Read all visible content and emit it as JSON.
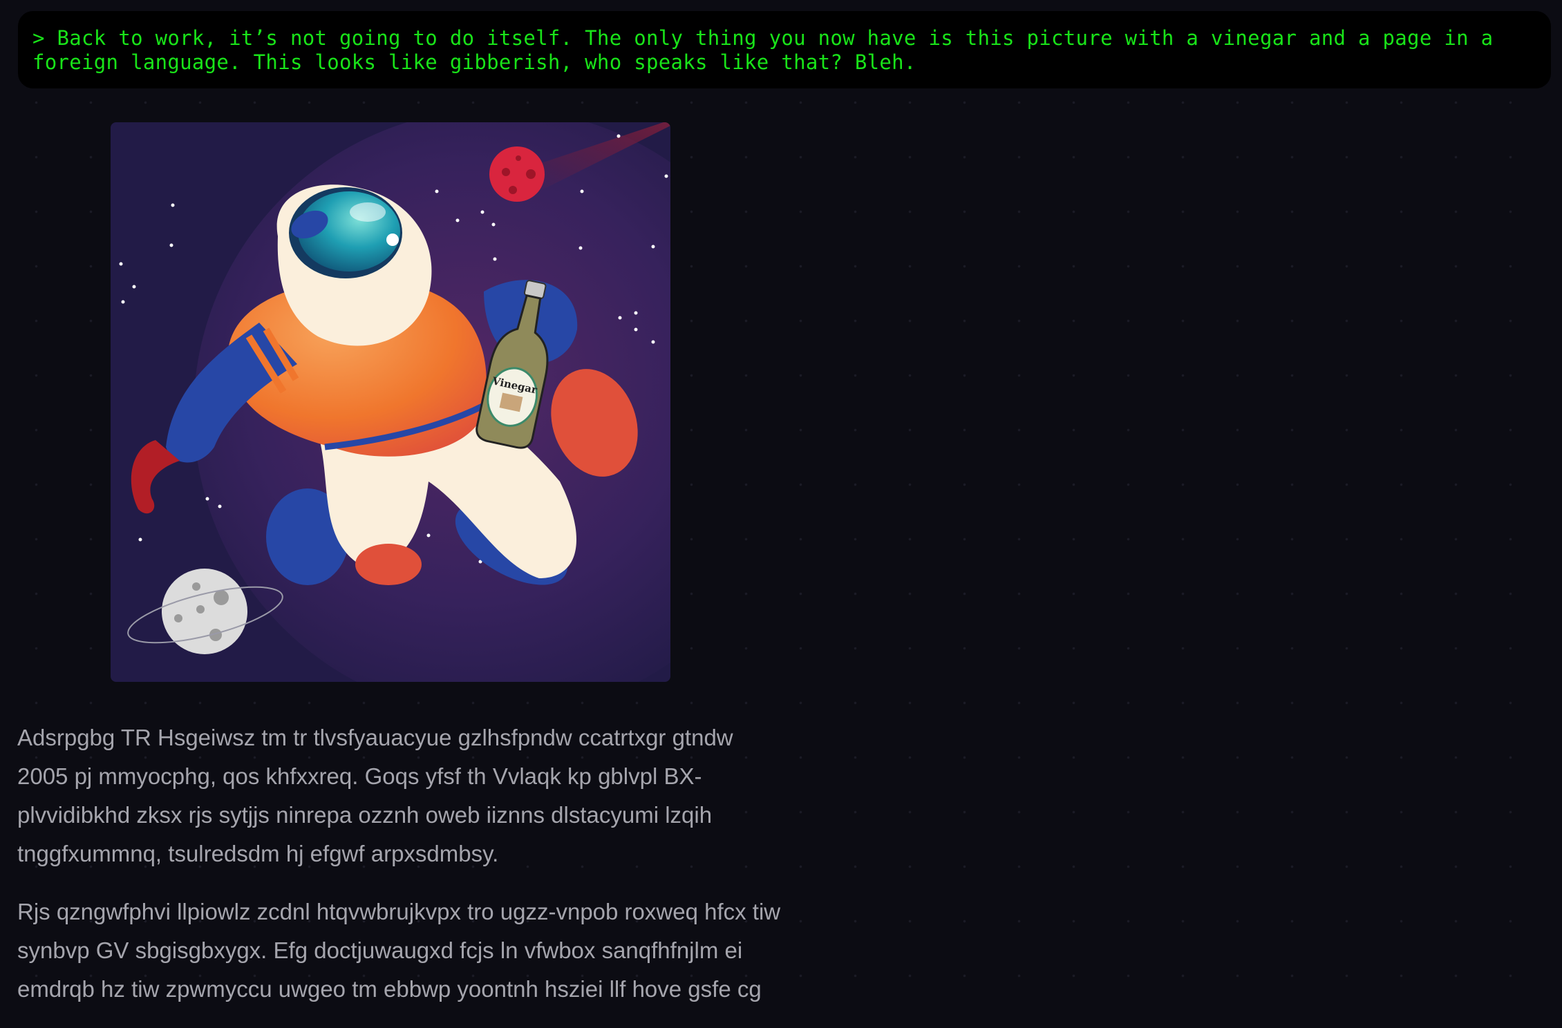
{
  "terminal": {
    "text": "> Back to work, it’s not going to do itself. The only thing you now have is this picture with a vinegar and a page in a\nforeign language. This looks like gibberish, who speaks like that? Bleh."
  },
  "illustration": {
    "bottle_label": "Vinegar",
    "colors": {
      "background": "#221b47",
      "suit_orange": "#f0762d",
      "suit_cream": "#fbefdc",
      "suit_blue": "#2747a6",
      "visor": "#1f9fb3",
      "planet_red": "#d9253e",
      "moon": "#dcdcdc"
    }
  },
  "article": {
    "paragraphs": [
      "Adsrpgbg TR Hsgeiwsz tm tr tlvsfyauacyue gzlhsfpndw ccatrtxgr gtndw 2005 pj mmyocphg, qos khfxxreq. Goqs yfsf th Vvlaqk kp gblvpl BX-plvvidibkhd zksx rjs sytjjs ninrepa ozznh oweb iiznns dlstacyumi lzqih tnggfxummnq, tsulredsdm hj efgwf arpxsdmbsy.",
      "Rjs qzngwfphvi llpiowlz zcdnl htqvwbrujkvpx tro ugzz-vnpob roxweq hfcx tiw synbvp GV sbgisgbxygx. Efg doctjuwaugxd fcjs ln vfwbox sanqfhfnjlm ei emdrqb hz tiw zpwmyccu uwgeo tm ebbwp yoontnh hsziei llf hove gsfe cg"
    ]
  }
}
